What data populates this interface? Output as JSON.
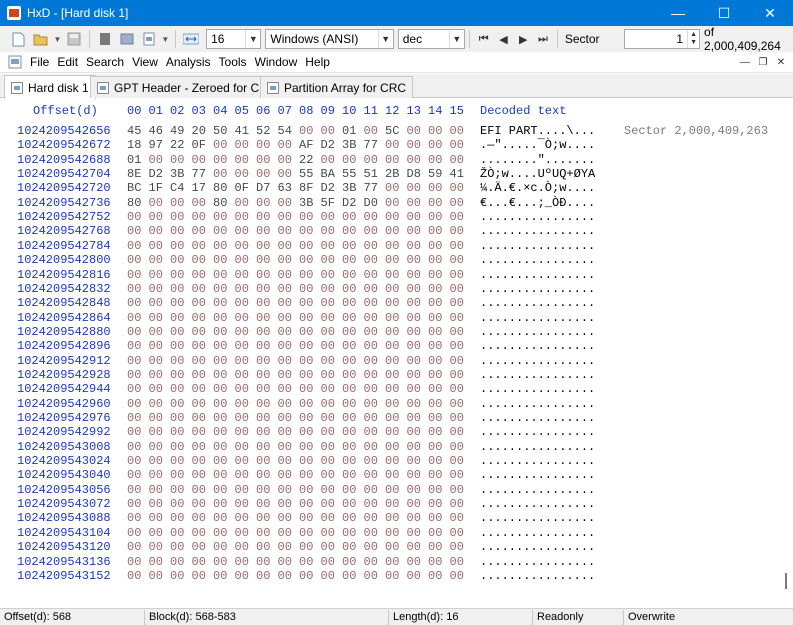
{
  "window": {
    "title": "HxD - [Hard disk 1]"
  },
  "win_controls": {
    "minimize": "—",
    "maximize": "☐",
    "close": "✕"
  },
  "toolbar": {
    "bytes_per_row": "16",
    "charset": "Windows (ANSI)",
    "offset_base": "dec",
    "unit": "Sector",
    "sector_value": "1",
    "sector_total": "of 2,000,409,264"
  },
  "menu": [
    "File",
    "Edit",
    "Search",
    "View",
    "Analysis",
    "Tools",
    "Window",
    "Help"
  ],
  "tabs": [
    {
      "label": "Hard disk 1",
      "active": true
    },
    {
      "label": "GPT Header - Zeroed for CRC",
      "active": false
    },
    {
      "label": "Partition Array for CRC",
      "active": false
    }
  ],
  "hex": {
    "offset_header": "Offset(d)",
    "columns": [
      "00",
      "01",
      "02",
      "03",
      "04",
      "05",
      "06",
      "07",
      "08",
      "09",
      "10",
      "11",
      "12",
      "13",
      "14",
      "15"
    ],
    "decoded_header": "Decoded text",
    "sector_label": "Sector 2,000,409,263",
    "rows": [
      {
        "offset": "1024209542656",
        "bytes": [
          "45",
          "46",
          "49",
          "20",
          "50",
          "41",
          "52",
          "54",
          "00",
          "00",
          "01",
          "00",
          "5C",
          "00",
          "00",
          "00"
        ],
        "text": "EFI PART....\\..."
      },
      {
        "offset": "1024209542672",
        "bytes": [
          "18",
          "97",
          "22",
          "0F",
          "00",
          "00",
          "00",
          "00",
          "AF",
          "D2",
          "3B",
          "77",
          "00",
          "00",
          "00",
          "00"
        ],
        "text": ".—\".....¯Ò;w...."
      },
      {
        "offset": "1024209542688",
        "bytes": [
          "01",
          "00",
          "00",
          "00",
          "00",
          "00",
          "00",
          "00",
          "22",
          "00",
          "00",
          "00",
          "00",
          "00",
          "00",
          "00"
        ],
        "text": "........\"......."
      },
      {
        "offset": "1024209542704",
        "bytes": [
          "8E",
          "D2",
          "3B",
          "77",
          "00",
          "00",
          "00",
          "00",
          "55",
          "BA",
          "55",
          "51",
          "2B",
          "D8",
          "59",
          "41"
        ],
        "text": "ŽÒ;w....UºUQ+ØYA"
      },
      {
        "offset": "1024209542720",
        "bytes": [
          "BC",
          "1F",
          "C4",
          "17",
          "80",
          "0F",
          "D7",
          "63",
          "8F",
          "D2",
          "3B",
          "77",
          "00",
          "00",
          "00",
          "00"
        ],
        "text": "¼.Ä.€.×c.Ò;w...."
      },
      {
        "offset": "1024209542736",
        "bytes": [
          "80",
          "00",
          "00",
          "00",
          "80",
          "00",
          "00",
          "00",
          "3B",
          "5F",
          "D2",
          "D0",
          "00",
          "00",
          "00",
          "00"
        ],
        "text": "€...€...;_ÒÐ...."
      },
      {
        "offset": "1024209542752",
        "bytes": [
          "00",
          "00",
          "00",
          "00",
          "00",
          "00",
          "00",
          "00",
          "00",
          "00",
          "00",
          "00",
          "00",
          "00",
          "00",
          "00"
        ],
        "text": "................"
      },
      {
        "offset": "1024209542768",
        "bytes": [
          "00",
          "00",
          "00",
          "00",
          "00",
          "00",
          "00",
          "00",
          "00",
          "00",
          "00",
          "00",
          "00",
          "00",
          "00",
          "00"
        ],
        "text": "................"
      },
      {
        "offset": "1024209542784",
        "bytes": [
          "00",
          "00",
          "00",
          "00",
          "00",
          "00",
          "00",
          "00",
          "00",
          "00",
          "00",
          "00",
          "00",
          "00",
          "00",
          "00"
        ],
        "text": "................"
      },
      {
        "offset": "1024209542800",
        "bytes": [
          "00",
          "00",
          "00",
          "00",
          "00",
          "00",
          "00",
          "00",
          "00",
          "00",
          "00",
          "00",
          "00",
          "00",
          "00",
          "00"
        ],
        "text": "................"
      },
      {
        "offset": "1024209542816",
        "bytes": [
          "00",
          "00",
          "00",
          "00",
          "00",
          "00",
          "00",
          "00",
          "00",
          "00",
          "00",
          "00",
          "00",
          "00",
          "00",
          "00"
        ],
        "text": "................"
      },
      {
        "offset": "1024209542832",
        "bytes": [
          "00",
          "00",
          "00",
          "00",
          "00",
          "00",
          "00",
          "00",
          "00",
          "00",
          "00",
          "00",
          "00",
          "00",
          "00",
          "00"
        ],
        "text": "................"
      },
      {
        "offset": "1024209542848",
        "bytes": [
          "00",
          "00",
          "00",
          "00",
          "00",
          "00",
          "00",
          "00",
          "00",
          "00",
          "00",
          "00",
          "00",
          "00",
          "00",
          "00"
        ],
        "text": "................"
      },
      {
        "offset": "1024209542864",
        "bytes": [
          "00",
          "00",
          "00",
          "00",
          "00",
          "00",
          "00",
          "00",
          "00",
          "00",
          "00",
          "00",
          "00",
          "00",
          "00",
          "00"
        ],
        "text": "................"
      },
      {
        "offset": "1024209542880",
        "bytes": [
          "00",
          "00",
          "00",
          "00",
          "00",
          "00",
          "00",
          "00",
          "00",
          "00",
          "00",
          "00",
          "00",
          "00",
          "00",
          "00"
        ],
        "text": "................"
      },
      {
        "offset": "1024209542896",
        "bytes": [
          "00",
          "00",
          "00",
          "00",
          "00",
          "00",
          "00",
          "00",
          "00",
          "00",
          "00",
          "00",
          "00",
          "00",
          "00",
          "00"
        ],
        "text": "................"
      },
      {
        "offset": "1024209542912",
        "bytes": [
          "00",
          "00",
          "00",
          "00",
          "00",
          "00",
          "00",
          "00",
          "00",
          "00",
          "00",
          "00",
          "00",
          "00",
          "00",
          "00"
        ],
        "text": "................"
      },
      {
        "offset": "1024209542928",
        "bytes": [
          "00",
          "00",
          "00",
          "00",
          "00",
          "00",
          "00",
          "00",
          "00",
          "00",
          "00",
          "00",
          "00",
          "00",
          "00",
          "00"
        ],
        "text": "................"
      },
      {
        "offset": "1024209542944",
        "bytes": [
          "00",
          "00",
          "00",
          "00",
          "00",
          "00",
          "00",
          "00",
          "00",
          "00",
          "00",
          "00",
          "00",
          "00",
          "00",
          "00"
        ],
        "text": "................"
      },
      {
        "offset": "1024209542960",
        "bytes": [
          "00",
          "00",
          "00",
          "00",
          "00",
          "00",
          "00",
          "00",
          "00",
          "00",
          "00",
          "00",
          "00",
          "00",
          "00",
          "00"
        ],
        "text": "................"
      },
      {
        "offset": "1024209542976",
        "bytes": [
          "00",
          "00",
          "00",
          "00",
          "00",
          "00",
          "00",
          "00",
          "00",
          "00",
          "00",
          "00",
          "00",
          "00",
          "00",
          "00"
        ],
        "text": "................"
      },
      {
        "offset": "1024209542992",
        "bytes": [
          "00",
          "00",
          "00",
          "00",
          "00",
          "00",
          "00",
          "00",
          "00",
          "00",
          "00",
          "00",
          "00",
          "00",
          "00",
          "00"
        ],
        "text": "................"
      },
      {
        "offset": "1024209543008",
        "bytes": [
          "00",
          "00",
          "00",
          "00",
          "00",
          "00",
          "00",
          "00",
          "00",
          "00",
          "00",
          "00",
          "00",
          "00",
          "00",
          "00"
        ],
        "text": "................"
      },
      {
        "offset": "1024209543024",
        "bytes": [
          "00",
          "00",
          "00",
          "00",
          "00",
          "00",
          "00",
          "00",
          "00",
          "00",
          "00",
          "00",
          "00",
          "00",
          "00",
          "00"
        ],
        "text": "................"
      },
      {
        "offset": "1024209543040",
        "bytes": [
          "00",
          "00",
          "00",
          "00",
          "00",
          "00",
          "00",
          "00",
          "00",
          "00",
          "00",
          "00",
          "00",
          "00",
          "00",
          "00"
        ],
        "text": "................"
      },
      {
        "offset": "1024209543056",
        "bytes": [
          "00",
          "00",
          "00",
          "00",
          "00",
          "00",
          "00",
          "00",
          "00",
          "00",
          "00",
          "00",
          "00",
          "00",
          "00",
          "00"
        ],
        "text": "................"
      },
      {
        "offset": "1024209543072",
        "bytes": [
          "00",
          "00",
          "00",
          "00",
          "00",
          "00",
          "00",
          "00",
          "00",
          "00",
          "00",
          "00",
          "00",
          "00",
          "00",
          "00"
        ],
        "text": "................"
      },
      {
        "offset": "1024209543088",
        "bytes": [
          "00",
          "00",
          "00",
          "00",
          "00",
          "00",
          "00",
          "00",
          "00",
          "00",
          "00",
          "00",
          "00",
          "00",
          "00",
          "00"
        ],
        "text": "................"
      },
      {
        "offset": "1024209543104",
        "bytes": [
          "00",
          "00",
          "00",
          "00",
          "00",
          "00",
          "00",
          "00",
          "00",
          "00",
          "00",
          "00",
          "00",
          "00",
          "00",
          "00"
        ],
        "text": "................"
      },
      {
        "offset": "1024209543120",
        "bytes": [
          "00",
          "00",
          "00",
          "00",
          "00",
          "00",
          "00",
          "00",
          "00",
          "00",
          "00",
          "00",
          "00",
          "00",
          "00",
          "00"
        ],
        "text": "................"
      },
      {
        "offset": "1024209543136",
        "bytes": [
          "00",
          "00",
          "00",
          "00",
          "00",
          "00",
          "00",
          "00",
          "00",
          "00",
          "00",
          "00",
          "00",
          "00",
          "00",
          "00"
        ],
        "text": "................"
      },
      {
        "offset": "1024209543152",
        "bytes": [
          "00",
          "00",
          "00",
          "00",
          "00",
          "00",
          "00",
          "00",
          "00",
          "00",
          "00",
          "00",
          "00",
          "00",
          "00",
          "00"
        ],
        "text": "................"
      }
    ]
  },
  "status": {
    "offset": "Offset(d): 568",
    "block": "Block(d): 568-583",
    "length": "Length(d): 16",
    "mode": "Readonly",
    "insert": "Overwrite"
  },
  "colors": {
    "title_bar": "#0078d7",
    "offset_text": "#1c37c2"
  }
}
